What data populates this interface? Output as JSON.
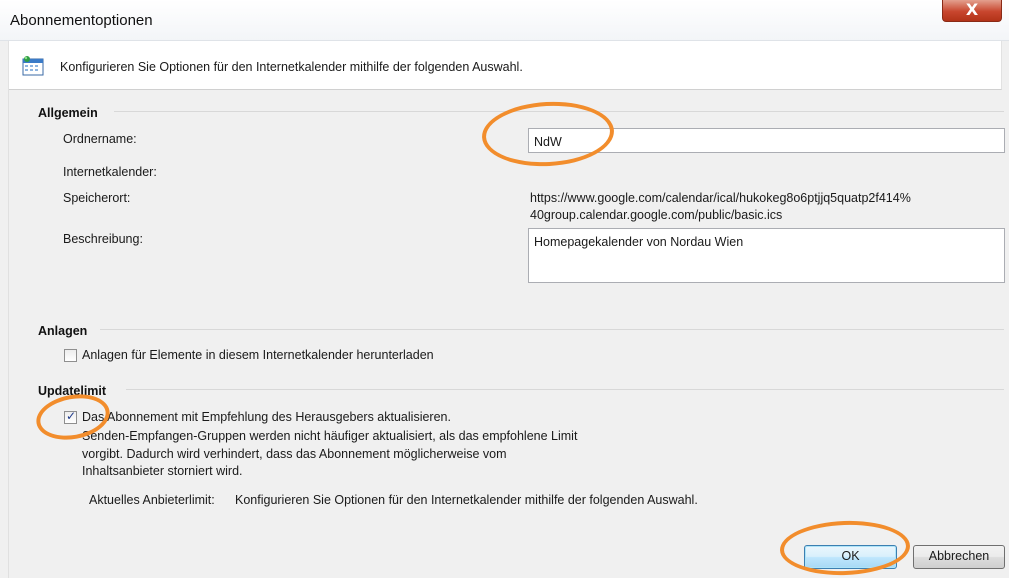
{
  "window": {
    "title": "Abonnementoptionen",
    "close_glyph": "X"
  },
  "header": {
    "icon": "calendar-icon",
    "text": "Konfigurieren Sie Optionen für den Internetkalender mithilfe der folgenden Auswahl."
  },
  "general": {
    "title": "Allgemein",
    "folder_label": "Ordnername:",
    "folder_value": "NdW",
    "internet_calendar_label": "Internetkalender:",
    "location_label": "Speicherort:",
    "location_line1": "https://www.google.com/calendar/ical/hukokeg8o6ptjjq5quatp2f414%",
    "location_line2": "40group.calendar.google.com/public/basic.ics",
    "description_label": "Beschreibung:",
    "description_value": "Homepagekalender von Nordau Wien"
  },
  "attachments": {
    "title": "Anlagen",
    "checkbox_label": "Anlagen für Elemente in diesem Internetkalender herunterladen",
    "checked": false
  },
  "update_limit": {
    "title": "Updatelimit",
    "checkbox_label": "Das Abonnement mit Empfehlung des Herausgebers aktualisieren.",
    "checked": true,
    "note_line1": "Senden-Empfangen-Gruppen werden nicht häufiger aktualisiert, als das empfohlene Limit",
    "note_line2": "vorgibt. Dadurch wird verhindert, dass das Abonnement möglicherweise vom",
    "note_line3": "Inhaltsanbieter storniert wird.",
    "current_label": "Aktuelles Anbieterlimit:",
    "current_value": "Konfigurieren Sie Optionen für den Internetkalender mithilfe der folgenden Auswahl."
  },
  "buttons": {
    "ok": "OK",
    "cancel": "Abbrechen"
  },
  "colors": {
    "annotation": "#f28d2c",
    "close_button": "#c8462e",
    "default_button_border": "#3c7fb1"
  }
}
